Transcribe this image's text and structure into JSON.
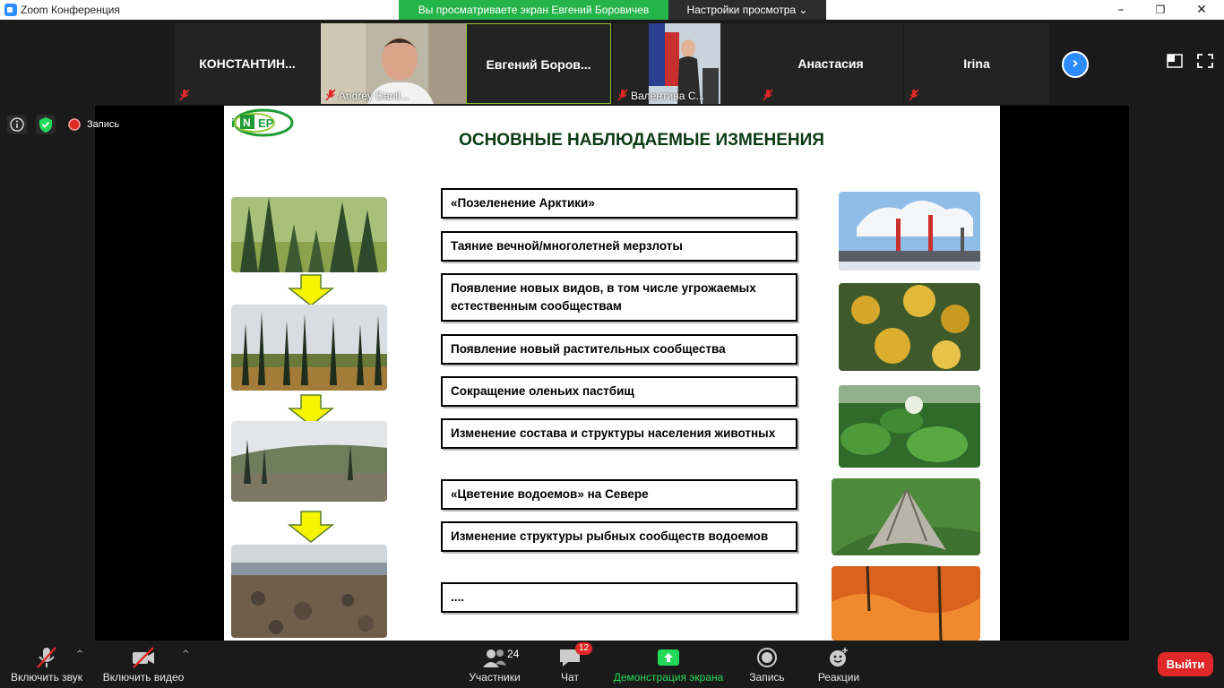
{
  "window": {
    "title": "Zoom Конференция",
    "minimize": "–",
    "maximize": "❐",
    "close": "✕"
  },
  "share_banner": {
    "text": "Вы просматриваете экран Евгений Боровичев",
    "view_options": "Настройки просмотра ⌄"
  },
  "gallery": {
    "tiles": [
      {
        "label": "КОНСТАНТИН...",
        "caption": ""
      },
      {
        "label": "",
        "caption": "Andrey Danil..."
      },
      {
        "label": "Евгений  Боров...",
        "caption": ""
      },
      {
        "label": "",
        "caption": "Валентина С..."
      },
      {
        "label": "Анастасия",
        "caption": ""
      },
      {
        "label": "Irina",
        "caption": ""
      }
    ],
    "next": "›"
  },
  "status": {
    "recording": "Запись"
  },
  "slide": {
    "title": "ОСНОВНЫЕ НАБЛЮДАЕМЫЕ ИЗМЕНЕНИЯ",
    "logo_text": "INENEP",
    "items": [
      "«Позеленение Арктики»",
      "Таяние вечной/многолетней мерзлоты",
      "Появление новых видов, в том числе угрожаемых естественным сообществам",
      "Появление новый растительных сообщества",
      "Сокращение оленьих пастбищ",
      "Изменение состава и структуры населения животных",
      "«Цветение водоемов» на Севере",
      "Изменение структуры рыбных сообществ водоемов",
      "...."
    ]
  },
  "toolbar": {
    "audio": "Включить звук",
    "video": "Включить видео",
    "participants": "Участники",
    "participants_count": "24",
    "chat": "Чат",
    "chat_badge": "12",
    "share": "Демонстрация экрана",
    "record": "Запись",
    "reactions": "Реакции",
    "leave": "Выйти"
  },
  "colors": {
    "accent_green": "#23d959",
    "zoom_blue": "#2d8cff",
    "leave_red": "#e02828",
    "slide_title": "#0b3a14"
  }
}
